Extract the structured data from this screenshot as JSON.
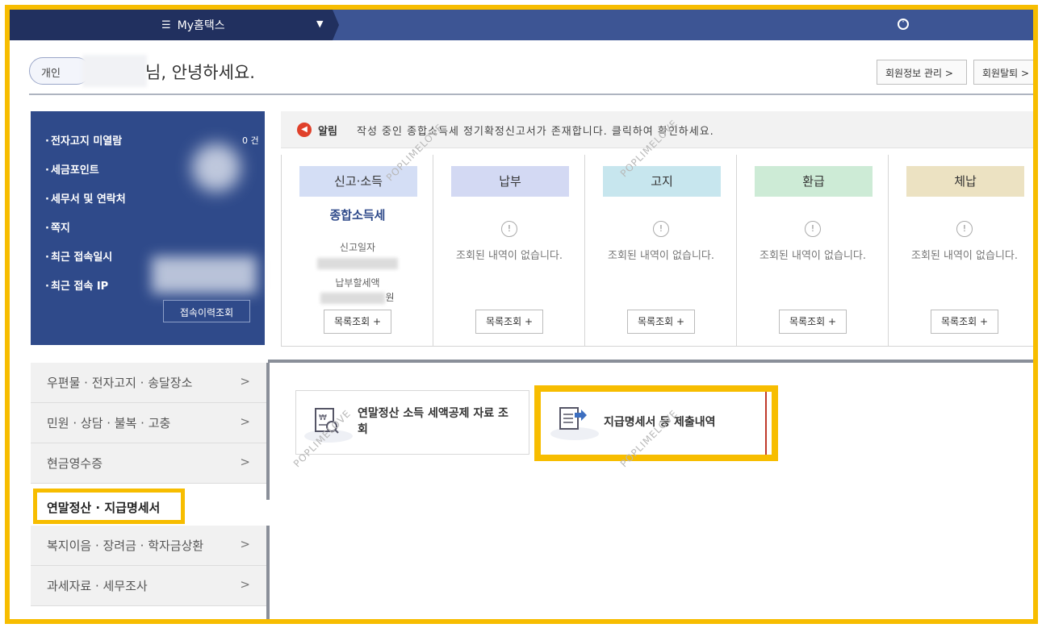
{
  "nav": {
    "menu_label": "My홈택스",
    "menu_icon": "hamburger-icon"
  },
  "greeting": {
    "pill": "개인",
    "text": "님, 안녕하세요."
  },
  "header_buttons": {
    "member_info": "회원정보 관리 >",
    "withdraw": "회원탈퇴 >"
  },
  "info_panel": {
    "items": [
      "전자고지 미열람",
      "세금포인트",
      "세무서 및 연락처",
      "쪽지",
      "최근 접속일시",
      "최근 접속 IP"
    ],
    "unread_count": "0 건",
    "history_button": "접속이력조회"
  },
  "alert": {
    "label": "알림",
    "text": "작성 중인 종합소득세 정기확정신고서가 존재합니다. 클릭하여 확인하세요."
  },
  "cards": [
    {
      "title": "신고·소득",
      "color": "#d4def5",
      "main": "종합소득세",
      "label1": "신고일자",
      "label2": "납부할세액",
      "amount_suffix": "원",
      "button": "목록조회 +"
    },
    {
      "title": "납부",
      "color": "#d3d9f3",
      "empty": "조회된 내역이 없습니다.",
      "button": "목록조회 +"
    },
    {
      "title": "고지",
      "color": "#c7e6ee",
      "empty": "조회된 내역이 없습니다.",
      "button": "목록조회 +"
    },
    {
      "title": "환급",
      "color": "#cdebd6",
      "empty": "조회된 내역이 없습니다.",
      "button": "목록조회 +"
    },
    {
      "title": "체납",
      "color": "#ece2c2",
      "empty": "조회된 내역이 없습니다.",
      "button": "목록조회 +"
    }
  ],
  "side_menu": {
    "items": [
      "우편물 · 전자고지 · 송달장소",
      "민원 · 상담 · 불복 · 고충",
      "현금영수증",
      "복지이음 · 장려금 · 학자금상환",
      "과세자료 · 세무조사"
    ],
    "active": "연말정산 · 지급명세서"
  },
  "tiles": {
    "tile1": "연말정산 소득 세액공제 자료 조회",
    "tile2": "지급명세서 등 제출내역"
  },
  "watermark": "POPLIMELOVE",
  "colors": {
    "accent_yellow": "#f7bd00",
    "nav_dark": "#21305f",
    "nav": "#3d5594",
    "panel_blue": "#2f4a8a"
  }
}
